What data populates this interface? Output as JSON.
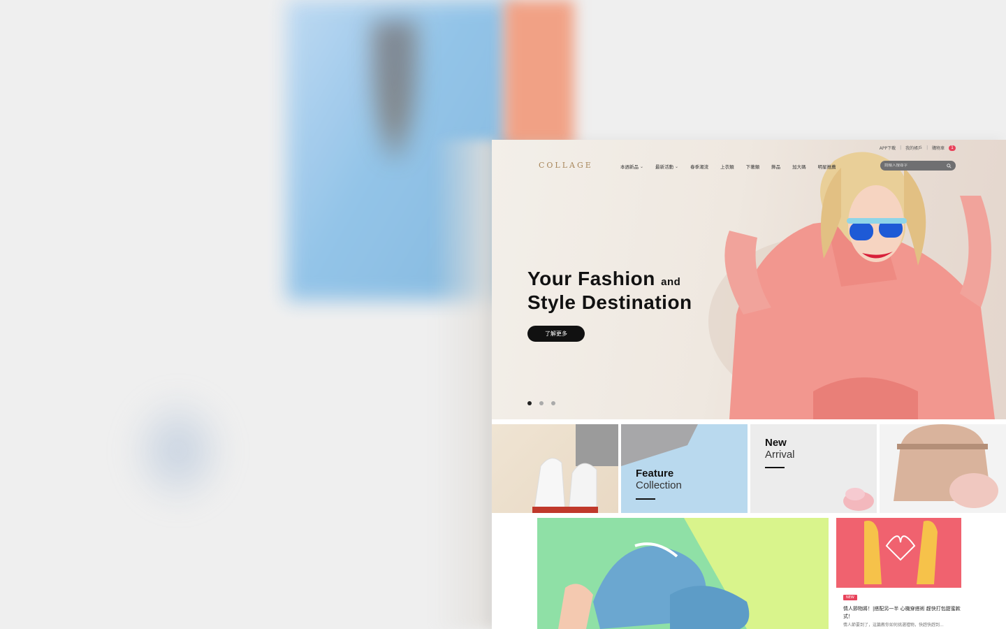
{
  "site": {
    "logo": "COLLAGE",
    "topbar": {
      "app_download": "APP下載",
      "my_account": "我的帳戶",
      "cart": "購物車",
      "cart_count": "1"
    },
    "nav": [
      {
        "label": "本週新品",
        "dropdown": true
      },
      {
        "label": "最新活動",
        "dropdown": true
      },
      {
        "label": "春季潮流",
        "dropdown": false
      },
      {
        "label": "上衣類",
        "dropdown": false
      },
      {
        "label": "下著類",
        "dropdown": false
      },
      {
        "label": "飾品",
        "dropdown": false
      },
      {
        "label": "加大碼",
        "dropdown": false
      },
      {
        "label": "明星推薦",
        "dropdown": false
      }
    ],
    "search": {
      "placeholder": "請輸入搜尋字",
      "icon": "search-icon"
    },
    "hero": {
      "title_line1": "Your Fashion",
      "title_and": "and",
      "title_line2": "Style Destination",
      "button": "了解更多",
      "dots": 3,
      "active_dot": 0
    },
    "tiles": [
      {
        "name": "sneakers"
      },
      {
        "name": "feature-collection",
        "bold": "Feature",
        "text": "Collection"
      },
      {
        "name": "new-arrival",
        "bold": "New",
        "text": "Arrival"
      },
      {
        "name": "bag"
      }
    ],
    "post": {
      "badge": "NEW",
      "title": "情人節物將！|搭配另一半 心機穿搭術 趕快打包甜蜜款式！",
      "excerpt": "情人節要到了，這篇教你如何挑選禮物，快趕快趕到..."
    },
    "colors": {
      "accent": "#e8425a",
      "logo": "#a8865a",
      "button": "#111111"
    }
  }
}
